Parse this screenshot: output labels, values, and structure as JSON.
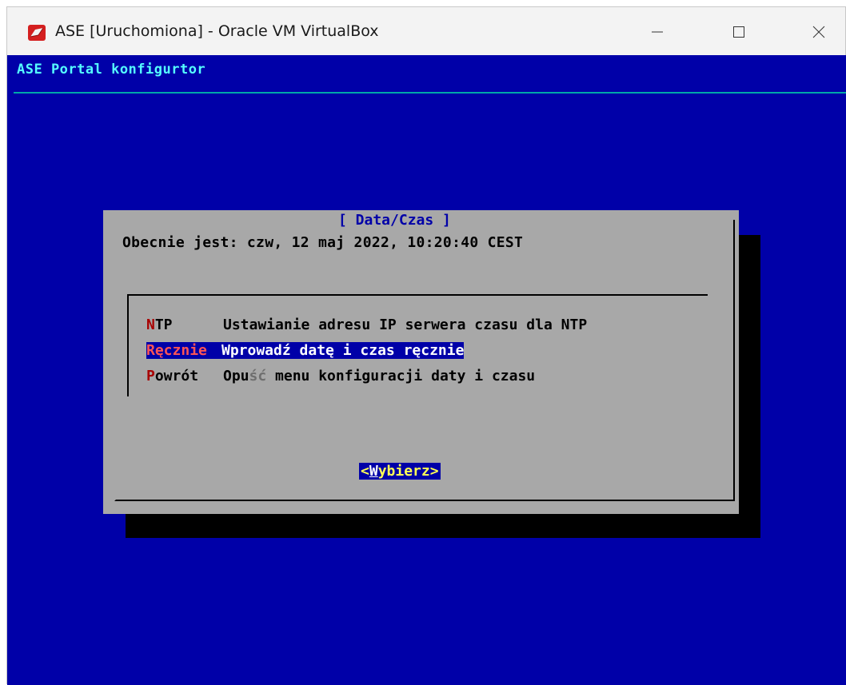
{
  "window": {
    "title": "ASE [Uruchomiona] - Oracle VM VirtualBox",
    "icon": "virtualbox-icon",
    "controls": [
      "minimize-icon",
      "maximize-icon",
      "close-icon"
    ]
  },
  "console": {
    "header": "ASE Portal konfigurtor",
    "dialog": {
      "title": "[ Data/Czas ]",
      "status": "Obecnie jest: czw, 12 maj 2022, 10:20:40 CEST",
      "menu": [
        {
          "tag_hot": "N",
          "tag_rest": "TP",
          "description": "Ustawianie adresu IP serwera czasu dla NTP"
        },
        {
          "tag_hot": "R",
          "tag_rest": "ęcznie",
          "description": "Wprowadź datę i czas ręcznie"
        },
        {
          "tag_hot": "P",
          "tag_rest": "owrót",
          "description_a": "Opu",
          "description_dim": "ść",
          "description_b": " menu konfiguracji daty i czasu"
        }
      ],
      "select_button": {
        "open": "<",
        "hot": "W",
        "rest": "ybierz",
        "close": ">"
      }
    },
    "colors": {
      "background": "#0000a8",
      "header": "#55ffff",
      "dialog": "#a8a8a8",
      "hotkey": "#a80000",
      "selection": "#0000a8"
    }
  }
}
